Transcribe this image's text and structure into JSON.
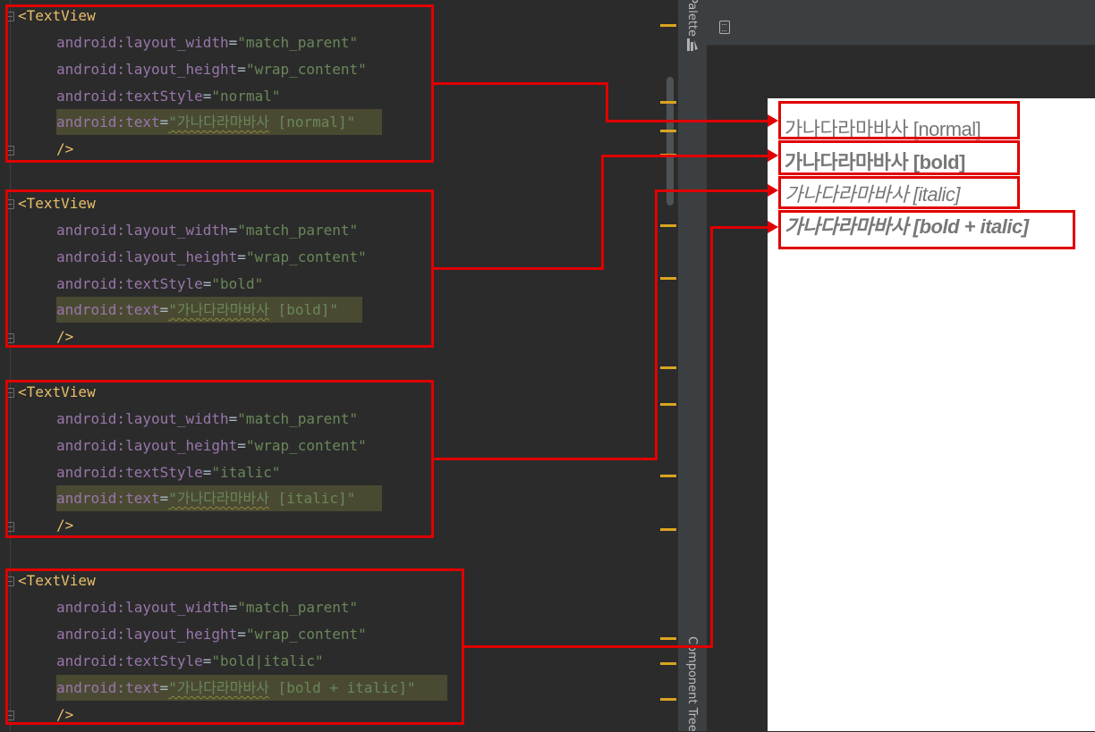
{
  "side_strip": {
    "palette_label": "Palette",
    "component_tree_label": "Component Tree"
  },
  "code_blocks": [
    {
      "tag_open": "<TextView",
      "layout_width_attr": "android:layout_width",
      "layout_width_value": "\"match_parent\"",
      "layout_height_attr": "android:layout_height",
      "layout_height_value": "\"wrap_content\"",
      "text_style_attr": "android:textStyle",
      "text_style_value": "\"normal\"",
      "text_attr": "android:text",
      "text_value_korean": "\"가나다라마바사",
      "text_value_rest": " [normal]\"",
      "tag_close": "/>"
    },
    {
      "tag_open": "<TextView",
      "layout_width_attr": "android:layout_width",
      "layout_width_value": "\"match_parent\"",
      "layout_height_attr": "android:layout_height",
      "layout_height_value": "\"wrap_content\"",
      "text_style_attr": "android:textStyle",
      "text_style_value": "\"bold\"",
      "text_attr": "android:text",
      "text_value_korean": "\"가나다라마바사",
      "text_value_rest": " [bold]\"",
      "tag_close": "/>"
    },
    {
      "tag_open": "<TextView",
      "layout_width_attr": "android:layout_width",
      "layout_width_value": "\"match_parent\"",
      "layout_height_attr": "android:layout_height",
      "layout_height_value": "\"wrap_content\"",
      "text_style_attr": "android:textStyle",
      "text_style_value": "\"italic\"",
      "text_attr": "android:text",
      "text_value_korean": "\"가나다라마바사",
      "text_value_rest": " [italic]\"",
      "tag_close": "/>"
    },
    {
      "tag_open": "<TextView",
      "layout_width_attr": "android:layout_width",
      "layout_width_value": "\"match_parent\"",
      "layout_height_attr": "android:layout_height",
      "layout_height_value": "\"wrap_content\"",
      "text_style_attr": "android:textStyle",
      "text_style_value": "\"bold|italic\"",
      "text_attr": "android:text",
      "text_value_korean": "\"가나다라마바사",
      "text_value_rest": " [bold + italic]\"",
      "tag_close": "/>"
    }
  ],
  "preview": {
    "items": [
      {
        "text": "가나다라마바사 [normal]",
        "style": "normal"
      },
      {
        "text": "가나다라마바사 [bold]",
        "style": "bold"
      },
      {
        "text": "가나다라마바사 [italic]",
        "style": "italic"
      },
      {
        "text": "가나다라마바사 [bold + italic]",
        "style": "bold-italic"
      }
    ]
  },
  "colors": {
    "annotation_red": "#e00000",
    "editor_background": "#2b2b2b",
    "tag_color": "#e8bf6a",
    "attribute_namespace": "#9876aa",
    "string_value": "#6a8759",
    "preview_text": "#777777"
  },
  "icons": [
    "fold-icon",
    "palette-icon",
    "design-surface-icon"
  ]
}
